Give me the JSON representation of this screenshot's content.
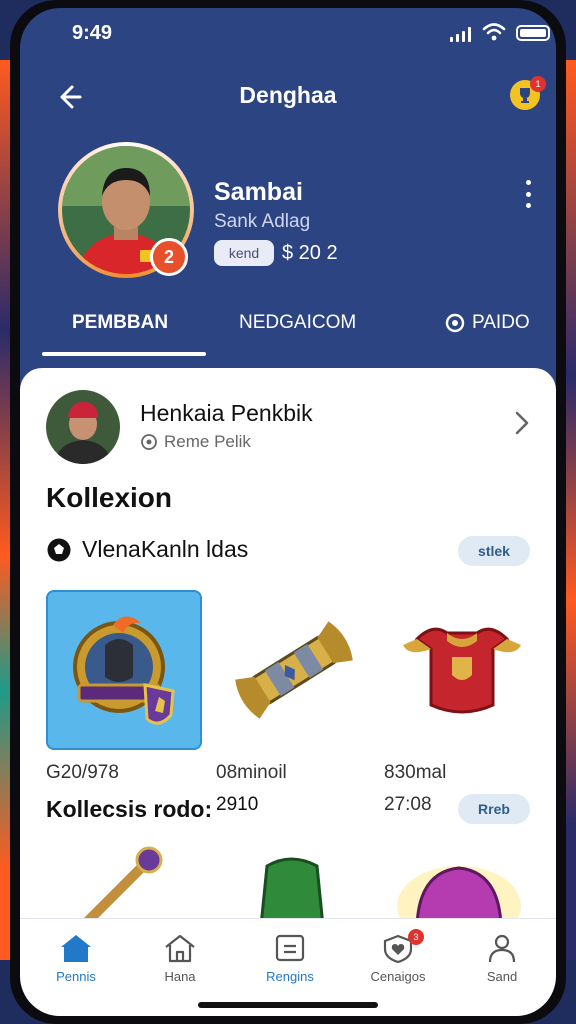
{
  "status_bar": {
    "time": "9:49"
  },
  "header": {
    "title": "Denghaa",
    "notif_count": "1"
  },
  "profile": {
    "name": "Sambai",
    "handle": "Sank Adlag",
    "tag": "kend",
    "value": "$ 20 2",
    "level": "2"
  },
  "tabs": [
    {
      "label": "PEMBBAN",
      "active": true
    },
    {
      "label": "NEDGAICOM",
      "active": false
    },
    {
      "label": "PAIDO",
      "active": false
    }
  ],
  "card": {
    "user_name": "Henkaia Penkbik",
    "user_sub": "Reme Pelik",
    "section_title": "Kollexion",
    "subsection_label": "VlenaKanln ldas",
    "pill_1": "stlek",
    "pill_2": "Rreb",
    "items": [
      {
        "name": "shield-crest",
        "caption": "G20/978"
      },
      {
        "name": "golden-bracers",
        "caption": "08minoil"
      },
      {
        "name": "red-armor",
        "caption": "830mal"
      }
    ],
    "footer_label": "Kollecsis rodo:",
    "footer_values": [
      "2910",
      "27:08"
    ]
  },
  "bottom_nav": [
    {
      "label": "Pennis",
      "icon": "home-filled-icon",
      "active": true
    },
    {
      "label": "Hana",
      "icon": "home-outline-icon",
      "active": false
    },
    {
      "label": "Rengins",
      "icon": "ticket-icon",
      "active": false
    },
    {
      "label": "Cenaigos",
      "icon": "shield-heart-icon",
      "active": false,
      "badge": "3"
    },
    {
      "label": "Sand",
      "icon": "person-icon",
      "active": false
    }
  ],
  "colors": {
    "header_bg": "#2d4482",
    "accent": "#2278c9",
    "badge_orange": "#e8502c",
    "pill_bg": "#dfeaf4"
  }
}
